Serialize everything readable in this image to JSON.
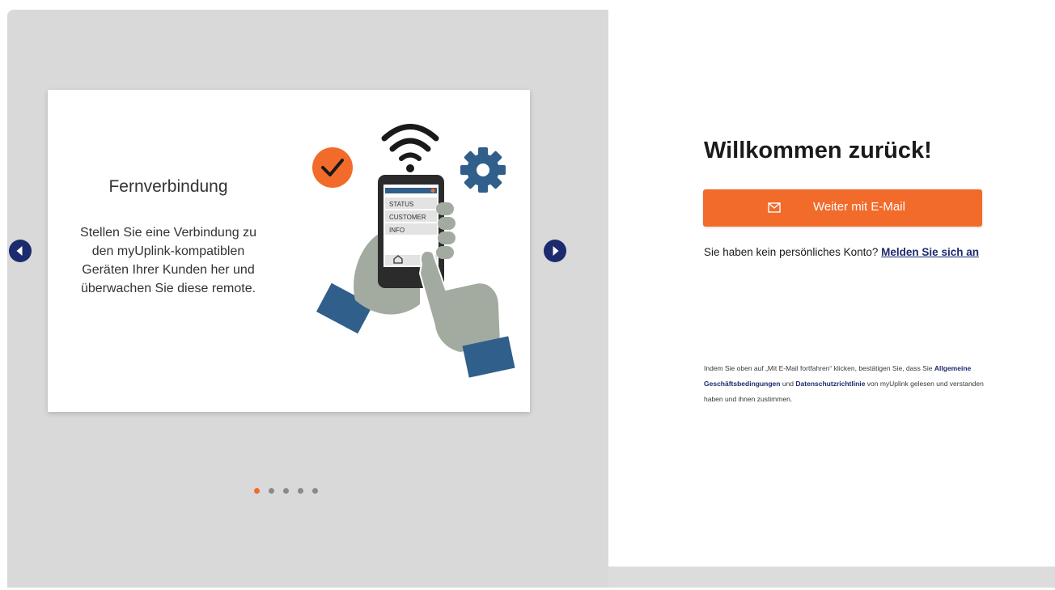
{
  "carousel": {
    "slide": {
      "title": "Fernverbindung",
      "text": "Stellen Sie eine Verbindung zu den myUplink-kompatiblen Geräten Ihrer Kunden her und überwachen Sie diese remote.",
      "phone_menu": [
        "STATUS",
        "CUSTOMER",
        "INFO"
      ]
    },
    "dots_total": 5,
    "active_dot": 1
  },
  "login": {
    "welcome": "Willkommen zurück!",
    "email_button": "Weiter mit E-Mail",
    "no_account_text": "Sie haben kein persönliches Konto?",
    "signup_link": "Melden Sie sich an",
    "legal_prefix": "Indem Sie oben auf „Mit E-Mail fortfahren“ klicken, bestätigen Sie, dass Sie",
    "terms_link": "Allgemeine Geschäftsbedingungen",
    "legal_and": "und",
    "privacy_link": "Datenschutzrichtlinie",
    "legal_suffix": "von myUplink gelesen und verstanden haben und ihnen zustimmen."
  },
  "colors": {
    "accent": "#f26b2a",
    "navy": "#1c2a6e",
    "panel_gray": "#d9d9d9",
    "hand_gray": "#a3aba0",
    "sleeve_blue": "#2f5f8a"
  },
  "icons": {
    "prev": "chevron-left-icon",
    "next": "chevron-right-icon",
    "mail": "mail-icon",
    "check": "check-circle-icon",
    "wifi": "wifi-icon",
    "gear": "gear-icon",
    "home": "home-icon"
  }
}
